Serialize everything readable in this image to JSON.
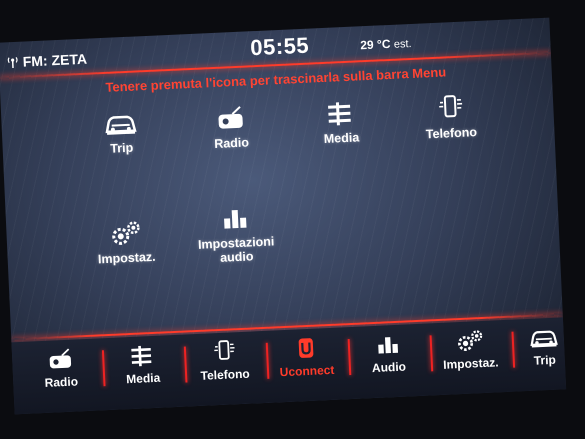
{
  "status": {
    "radio_source": "FM: ZETA",
    "clock": "05:55",
    "temperature": "29 °C",
    "temperature_note": "est."
  },
  "hint": "Tenere premuta l'icona per trascinarla sulla barra Menu",
  "apps": [
    {
      "label": "Trip",
      "icon": "car-icon"
    },
    {
      "label": "Radio",
      "icon": "radio-icon"
    },
    {
      "label": "Media",
      "icon": "media-icon"
    },
    {
      "label": "Telefono",
      "icon": "phone-icon"
    },
    {
      "label": "Impostaz.",
      "icon": "gears-icon"
    },
    {
      "label": "Impostazioni audio",
      "icon": "audio-bars-icon"
    }
  ],
  "menu_bar": [
    {
      "label": "Radio",
      "icon": "radio-icon"
    },
    {
      "label": "Media",
      "icon": "media-icon"
    },
    {
      "label": "Telefono",
      "icon": "phone-icon"
    },
    {
      "label": "Uconnect",
      "icon": "uconnect-icon",
      "active": true
    },
    {
      "label": "Audio",
      "icon": "audio-bars-icon"
    },
    {
      "label": "Impostaz.",
      "icon": "gears-icon"
    },
    {
      "label": "Trip",
      "icon": "car-icon"
    }
  ],
  "colors": {
    "accent": "#ff3b2a",
    "text": "#ffffff",
    "background": "#35405a"
  }
}
